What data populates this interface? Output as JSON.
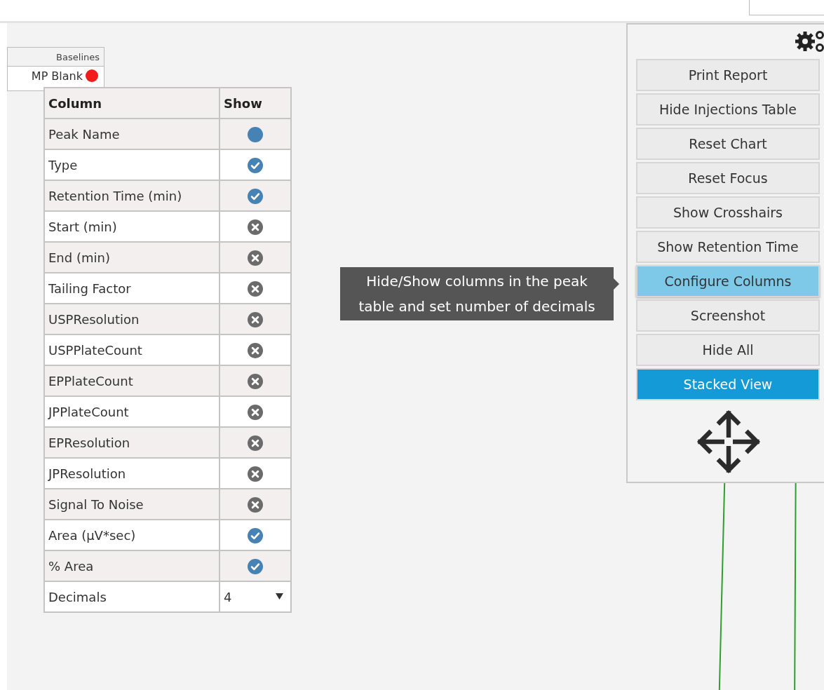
{
  "baselines": {
    "header": "Baselines",
    "cell": "MP Blank"
  },
  "column_table": {
    "headers": [
      "Column",
      "Show"
    ],
    "rows": [
      {
        "name": "Peak Name",
        "shown": true,
        "locked": true
      },
      {
        "name": "Type",
        "shown": true,
        "locked": false
      },
      {
        "name": "Retention Time (min)",
        "shown": true,
        "locked": false
      },
      {
        "name": "Start (min)",
        "shown": false,
        "locked": false
      },
      {
        "name": "End (min)",
        "shown": false,
        "locked": false
      },
      {
        "name": "Tailing Factor",
        "shown": false,
        "locked": false
      },
      {
        "name": "USPResolution",
        "shown": false,
        "locked": false
      },
      {
        "name": "USPPlateCount",
        "shown": false,
        "locked": false
      },
      {
        "name": "EPPlateCount",
        "shown": false,
        "locked": false
      },
      {
        "name": "JPPlateCount",
        "shown": false,
        "locked": false
      },
      {
        "name": "EPResolution",
        "shown": false,
        "locked": false
      },
      {
        "name": "JPResolution",
        "shown": false,
        "locked": false
      },
      {
        "name": "Signal To Noise",
        "shown": false,
        "locked": false
      },
      {
        "name": "Area (µV*sec)",
        "shown": true,
        "locked": false
      },
      {
        "name": "% Area",
        "shown": true,
        "locked": false
      }
    ],
    "decimals": {
      "label": "Decimals",
      "value": "4"
    }
  },
  "tooltip": "Hide/Show columns in the peak table and set number of decimals",
  "toolbar": {
    "buttons": [
      {
        "label": "Print Report",
        "hovered": false,
        "selected": false
      },
      {
        "label": "Hide Injections Table",
        "hovered": false,
        "selected": false
      },
      {
        "label": "Reset Chart",
        "hovered": false,
        "selected": false
      },
      {
        "label": "Reset Focus",
        "hovered": false,
        "selected": false
      },
      {
        "label": "Show Crosshairs",
        "hovered": false,
        "selected": false
      },
      {
        "label": "Show Retention Time",
        "hovered": false,
        "selected": false
      },
      {
        "label": "Configure Columns",
        "hovered": true,
        "selected": false
      },
      {
        "label": "Screenshot",
        "hovered": false,
        "selected": false
      },
      {
        "label": "Hide All",
        "hovered": false,
        "selected": false
      },
      {
        "label": "Stacked View",
        "hovered": false,
        "selected": true
      }
    ]
  }
}
